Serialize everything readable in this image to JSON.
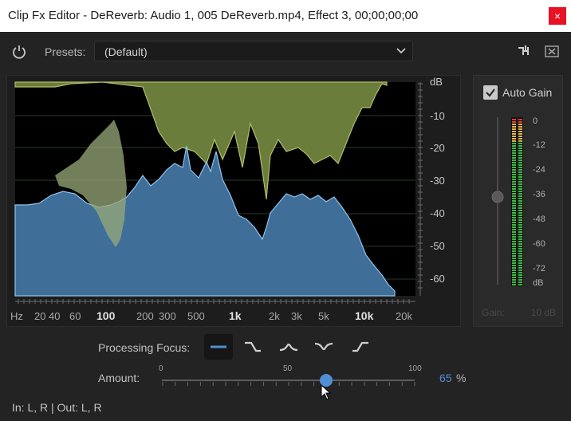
{
  "window": {
    "title": "Clip Fx Editor - DeReverb: Audio 1, 005 DeReverb.mp4, Effect 3, 00;00;00;00",
    "close_glyph": "×"
  },
  "toolbar": {
    "presets_label": "Presets:",
    "preset_value": "(Default)",
    "icons": [
      "power-icon",
      "chevron-down-icon",
      "route-icon",
      "close-box-icon"
    ]
  },
  "spectrum": {
    "db_axis": [
      "dB",
      "-10",
      "-20",
      "-30",
      "-40",
      "-50",
      "-60"
    ],
    "hz_axis": [
      "Hz",
      "20",
      "40",
      "60",
      "100",
      "200",
      "300",
      "500",
      "1k",
      "2k",
      "3k",
      "5k",
      "10k",
      "20k"
    ],
    "colors": {
      "reverb_fill": "#6b7d3a",
      "reverb_line": "#aebc6a",
      "dry_fill": "#3f6f99",
      "dry_line": "#8ec4ec",
      "background": "#000000"
    }
  },
  "auto_gain": {
    "label": "Auto Gain",
    "checked": true,
    "scale": [
      "0",
      "-12",
      "-24",
      "-36",
      "-48",
      "-60",
      "-72",
      "dB"
    ],
    "gain_label": "Gain:",
    "gain_value": "10 dB"
  },
  "processing_focus": {
    "label": "Processing Focus:",
    "options": [
      "focus-flat-icon",
      "focus-high-cut-icon",
      "focus-mid-icon",
      "focus-mid-cut-icon",
      "focus-high-boost-icon"
    ],
    "selected": 0
  },
  "amount": {
    "label": "Amount:",
    "tick_labels": [
      "0",
      "50",
      "100"
    ],
    "value": "65",
    "unit": "%",
    "fraction": 0.65
  },
  "status": {
    "text": "In: L, R | Out: L, R"
  }
}
